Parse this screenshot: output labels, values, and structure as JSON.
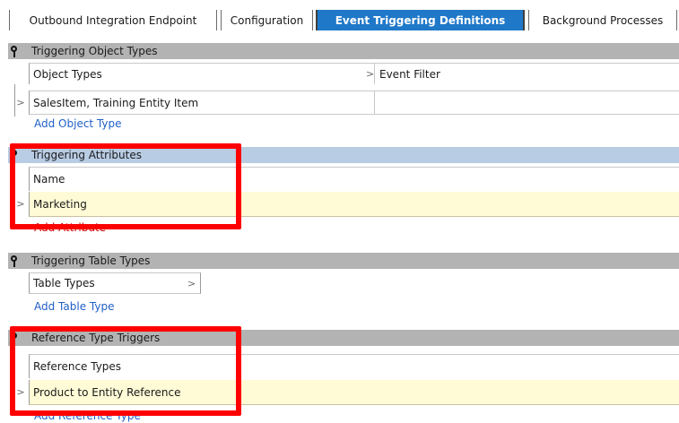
{
  "tabs": [
    {
      "label": "Outbound Integration Endpoint"
    },
    {
      "label": "Configuration"
    },
    {
      "label": "Event Triggering Definitions"
    },
    {
      "label": "Background Processes"
    }
  ],
  "sections": {
    "object_types": {
      "title": "Triggering Object Types",
      "col1_header": "Object Types",
      "col2_header": "Event Filter",
      "row_value": "SalesItem, Training Entity Item",
      "add_label": "Add Object Type"
    },
    "attributes": {
      "title": "Triggering Attributes",
      "col_header": "Name",
      "row_value": "Marketing",
      "add_label": "Add Attribute"
    },
    "table_types": {
      "title": "Triggering Table Types",
      "col_header": "Table Types",
      "add_label": "Add Table Type"
    },
    "reference_types": {
      "title": "Reference Type Triggers",
      "col_header": "Reference Types",
      "row_value": "Product to Entity Reference",
      "add_label": "Add Reference Type"
    }
  },
  "glyphs": {
    "expand": ">",
    "sort": ">"
  },
  "colors": {
    "active_tab": "#1f78c8",
    "section_bar": "#b3b3b3",
    "section_bar_selected": "#b8cce4",
    "row_highlight": "#fffbd6",
    "link": "#1f5fc8",
    "annotation": "#ff0000"
  },
  "icons": {
    "section_pin": "pin-icon"
  }
}
